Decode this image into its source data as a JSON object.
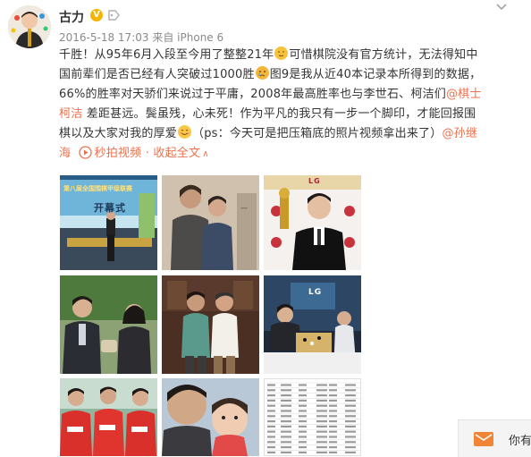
{
  "user": {
    "name": "古力",
    "verified_badge": "V",
    "badge_color": "#f5b400"
  },
  "meta": {
    "timestamp": "2016-5-18 17:03",
    "source_prefix": "来自",
    "device": "iPhone 6"
  },
  "post": {
    "l1a": "千胜！从95年6月入段至今用了整整21年",
    "l1b": "可惜棋院没有官方统计，无法得知中",
    "l2a": "国前辈们是否已经有人突破过1000胜",
    "l2b": "图9是我从近40本记录本所得到的数据，",
    "l3a": "66%的胜率对天骄们来说过于平庸，2008年最高胜率也与李世石、柯洁们",
    "l3_mention": "@棋士",
    "l4_mention": "柯洁",
    "l4a": " 差距甚远。鬓虽残，心未死！作为平凡的我只有一步一个脚印，才能回报围",
    "l5a": "棋以及大家对我的厚爱",
    "l5b": "（ps：今天可是把压箱底的照片视频拿出来了）",
    "l5_mention": "@孙继",
    "l6_mention": "海",
    "l6_video": "秒拍视频",
    "l6_sep": "· ",
    "l6_collapse": "收起全文",
    "l6_arrow": "∧"
  },
  "photos": {
    "p1_banner": "第八届全国围棋甲级联赛",
    "p1_caption": "开幕式",
    "p3_logo": "LG",
    "p5_banner": "LG"
  },
  "chat": {
    "label": "你有"
  },
  "colors": {
    "link": "#eb7350",
    "meta": "#8a8a8a",
    "text": "#333333"
  }
}
